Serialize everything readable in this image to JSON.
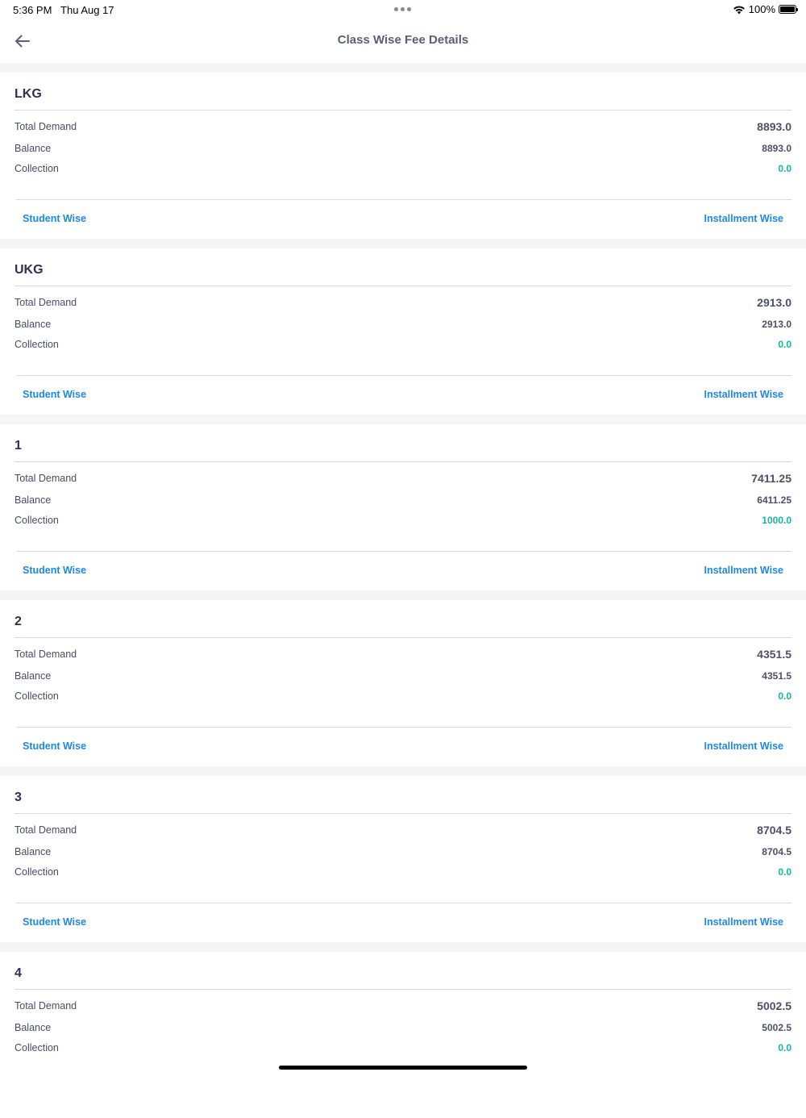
{
  "status_bar": {
    "time": "5:36 PM",
    "date": "Thu Aug 17",
    "battery_text": "100%",
    "icons": [
      "more-dots-icon",
      "wifi-icon",
      "battery-icon"
    ]
  },
  "header": {
    "title": "Class Wise Fee Details",
    "back_icon": "arrow-left-icon"
  },
  "labels": {
    "total_demand": "Total Demand",
    "balance": "Balance",
    "collection": "Collection",
    "student_wise": "Student Wise",
    "installment_wise": "Installment Wise"
  },
  "classes": [
    {
      "name": "LKG",
      "total_demand": "8893.0",
      "balance": "8893.0",
      "collection": "0.0"
    },
    {
      "name": "UKG",
      "total_demand": "2913.0",
      "balance": "2913.0",
      "collection": "0.0"
    },
    {
      "name": "1",
      "total_demand": "7411.25",
      "balance": "6411.25",
      "collection": "1000.0"
    },
    {
      "name": "2",
      "total_demand": "4351.5",
      "balance": "4351.5",
      "collection": "0.0"
    },
    {
      "name": "3",
      "total_demand": "8704.5",
      "balance": "8704.5",
      "collection": "0.0"
    },
    {
      "name": "4",
      "total_demand": "5002.5",
      "balance": "5002.5",
      "collection": "0.0"
    }
  ],
  "colors": {
    "title": "#2d2f55",
    "label": "#4a4c66",
    "value": "#4e5068",
    "collection": "#1bb3a0",
    "link": "#1e88e5",
    "section_gap": "#f5f5f8"
  }
}
